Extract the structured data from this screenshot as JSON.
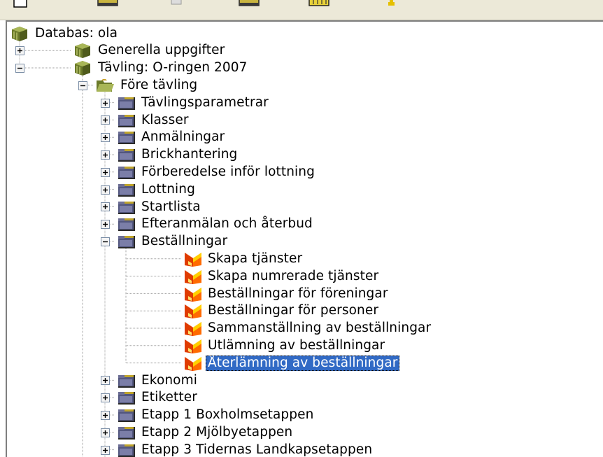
{
  "colors": {
    "selection": "#316ac5",
    "tree_line": "#a0a0a0",
    "expander_border": "#7b8ea6"
  },
  "toolbar": {
    "icons": [
      "blank-page-icon",
      "folder-icon",
      "print-icon",
      "edit-icon",
      "table-icon",
      "key-icon"
    ]
  },
  "tree": {
    "nodes": [
      {
        "label": "Databas: ola",
        "level": 0,
        "icon": "database-icon",
        "expander": "none"
      },
      {
        "label": "Generella uppgifter",
        "level": 1,
        "icon": "database-icon",
        "expander": "plus"
      },
      {
        "label": "Tävling: O-ringen 2007",
        "level": 1,
        "icon": "database-icon",
        "expander": "minus"
      },
      {
        "label": "Före tävling",
        "level": 2,
        "icon": "open-folder-icon",
        "expander": "minus"
      },
      {
        "label": "Tävlingsparametrar",
        "level": 3,
        "icon": "folder-icon",
        "expander": "plus"
      },
      {
        "label": "Klasser",
        "level": 3,
        "icon": "folder-icon",
        "expander": "plus"
      },
      {
        "label": "Anmälningar",
        "level": 3,
        "icon": "folder-icon",
        "expander": "plus"
      },
      {
        "label": "Brickhantering",
        "level": 3,
        "icon": "folder-icon",
        "expander": "plus"
      },
      {
        "label": "Förberedelse inför lottning",
        "level": 3,
        "icon": "folder-icon",
        "expander": "plus"
      },
      {
        "label": "Lottning",
        "level": 3,
        "icon": "folder-icon",
        "expander": "plus"
      },
      {
        "label": "Startlista",
        "level": 3,
        "icon": "folder-icon",
        "expander": "plus"
      },
      {
        "label": "Efteranmälan och återbud",
        "level": 3,
        "icon": "folder-icon",
        "expander": "plus"
      },
      {
        "label": "Beställningar",
        "level": 3,
        "icon": "folder-icon",
        "expander": "minus"
      },
      {
        "label": "Skapa tjänster",
        "level": 4,
        "icon": "function-icon",
        "expander": "none"
      },
      {
        "label": "Skapa numrerade tjänster",
        "level": 4,
        "icon": "function-icon",
        "expander": "none"
      },
      {
        "label": "Beställningar för föreningar",
        "level": 4,
        "icon": "function-icon",
        "expander": "none"
      },
      {
        "label": "Beställningar för personer",
        "level": 4,
        "icon": "function-icon",
        "expander": "none"
      },
      {
        "label": "Sammanställning av beställningar",
        "level": 4,
        "icon": "function-icon",
        "expander": "none"
      },
      {
        "label": "Utlämning av beställningar",
        "level": 4,
        "icon": "function-icon",
        "expander": "none"
      },
      {
        "label": "Återlämning av beställningar",
        "level": 4,
        "icon": "function-icon",
        "expander": "none",
        "selected": true
      },
      {
        "label": "Ekonomi",
        "level": 3,
        "icon": "folder-icon",
        "expander": "plus"
      },
      {
        "label": "Etiketter",
        "level": 3,
        "icon": "folder-icon",
        "expander": "plus"
      },
      {
        "label": "Etapp 1 Boxholmsetappen",
        "level": 3,
        "icon": "folder-icon",
        "expander": "plus"
      },
      {
        "label": "Etapp 2 Mjölbyetappen",
        "level": 3,
        "icon": "folder-icon",
        "expander": "plus"
      },
      {
        "label": "Etapp 3 Tidernas Landkapsetappen",
        "level": 3,
        "icon": "folder-icon",
        "expander": "plus"
      }
    ]
  }
}
